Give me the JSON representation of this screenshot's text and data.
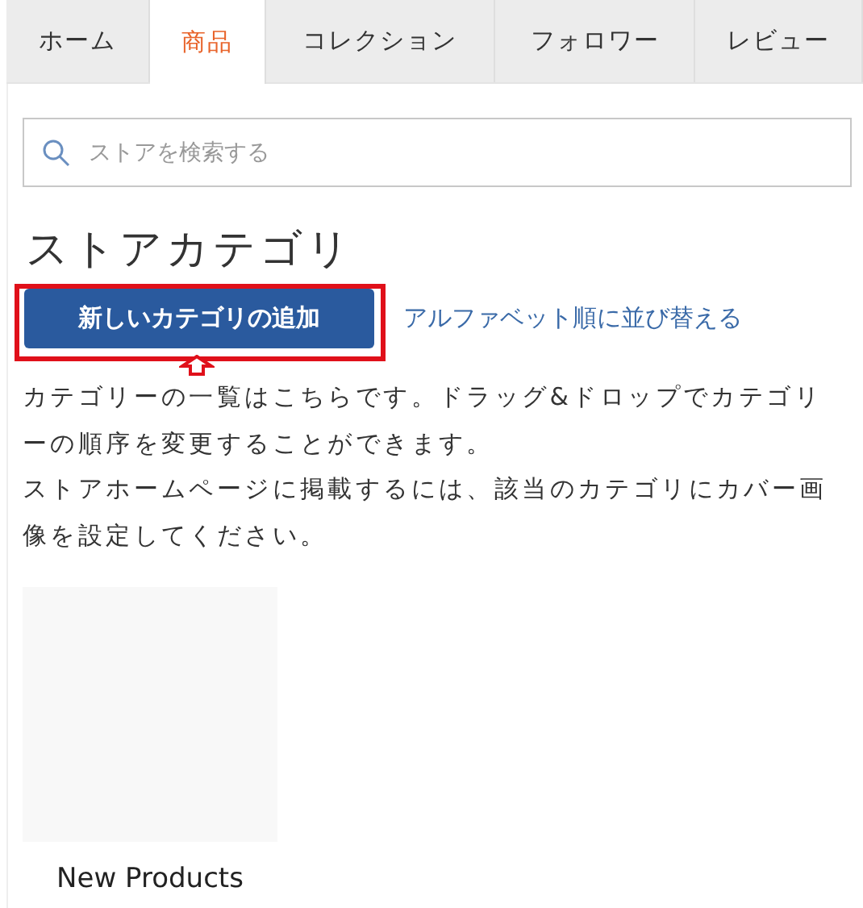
{
  "tabs": [
    {
      "label": "ホーム",
      "selected": false
    },
    {
      "label": "商品",
      "selected": true
    },
    {
      "label": "コレクション",
      "selected": false
    },
    {
      "label": "フォロワー",
      "selected": false
    },
    {
      "label": "レビュー",
      "selected": false
    }
  ],
  "search": {
    "placeholder": "ストアを検索する"
  },
  "heading": "ストアカテゴリ",
  "add_button": "新しいカテゴリの追加",
  "sort_link": "アルファベット順に並び替える",
  "description": [
    "カテゴリーの一覧はこちらです。ドラッグ&ドロップでカテゴリーの順序を変更することができます。",
    "ストアホームページに掲載するには、該当のカテゴリにカバー画像を設定してください。"
  ],
  "categories": [
    {
      "name": "New Products"
    }
  ]
}
